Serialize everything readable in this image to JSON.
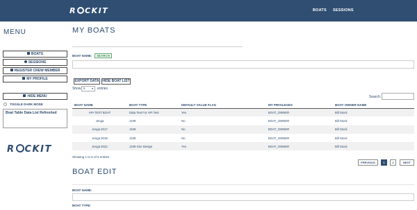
{
  "navbar": {
    "logo_text": "ROCKIT",
    "links": [
      "BOATS",
      "SESSIONS"
    ]
  },
  "sidebar": {
    "title": "MENU",
    "items": [
      {
        "label": "BOATS",
        "icon": "ship-icon"
      },
      {
        "label": "SESSIONS",
        "icon": "globe-icon"
      },
      {
        "label": "REGISTER CREW MEMBER",
        "icon": "users-icon"
      },
      {
        "label": "MY PROFILE",
        "icon": "profile-icon"
      }
    ],
    "hide_menu_label": "HIDE MENU",
    "dark_mode_label": "TOGGLE DARK MODE",
    "notification": "Boat Table Data List Refreshed",
    "logo_text": "ROCKIT"
  },
  "my_boats": {
    "title": "MY BOATS",
    "boat_name_label": "BOAT NAME:",
    "search_button": "SEARCH",
    "export_button": "EXPORT DATA",
    "hide_list_button": "HIDE BOAT LIST",
    "show_label": "Show",
    "show_value": "5",
    "entries_label": "entries",
    "search_label": "Search:",
    "columns": [
      "BOAT NAME",
      "BOAT TYPE",
      "DEFAULT VALUE FLAG",
      "MY PRIVILEGES",
      "BOAT OWNER NAME"
    ],
    "rows": [
      [
        "API TEST BOAT",
        "Data Test For API Test",
        "Yes",
        "BOAT_OWNER",
        "Bill Stock"
      ],
      [
        "Jenga",
        "J109",
        "No",
        "BOAT_OWNER",
        "Bill Stock"
      ],
      [
        "Jenga 2017",
        "J109",
        "No",
        "BOAT_OWNER",
        "Bill Stock"
      ],
      [
        "Jenga 2018",
        "J109",
        "No",
        "BOAT_OWNER",
        "Bill Stock"
      ],
      [
        "Jenga 2022",
        "J109 One Design",
        "Yes",
        "BOAT_OWNER",
        "Bill Stock"
      ]
    ],
    "showing_text": "Showing 1 to 5 of 6 entries",
    "pagination": {
      "previous": "PREVIOUS",
      "pages": [
        "1",
        "2"
      ],
      "next": "NEXT"
    }
  },
  "boat_edit": {
    "title": "BOAT EDIT",
    "boat_name_label": "BOAT NAME:",
    "boat_type_label": "BOAT TYPE:"
  },
  "colors": {
    "navbar": "#2f4e72",
    "text": "#2c4a6e",
    "search_button": "#3a8a4f",
    "active_page": "#2f4e72"
  }
}
